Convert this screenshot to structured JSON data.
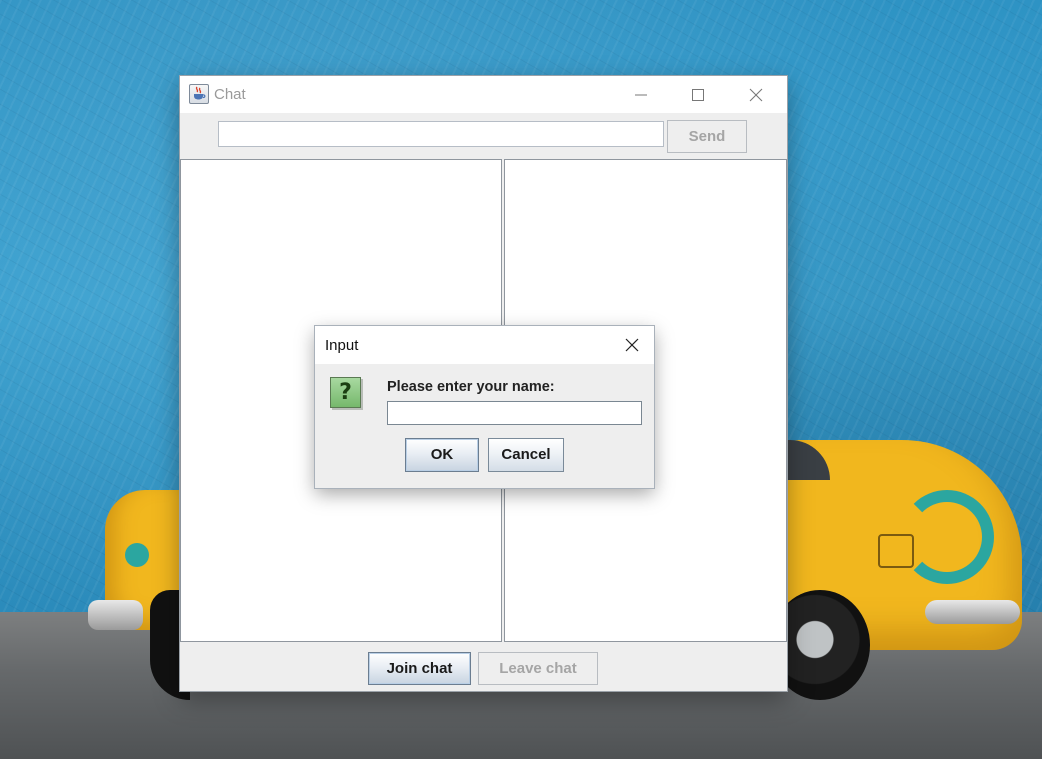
{
  "window": {
    "title": "Chat",
    "app_icon": "java-coffee-cup-icon",
    "controls": {
      "minimize": "minimize-icon",
      "maximize": "maximize-icon",
      "close": "close-icon"
    }
  },
  "toolbar": {
    "message_value": "",
    "send_label": "Send",
    "send_enabled": false
  },
  "panes": {
    "messages": [],
    "users": []
  },
  "bottombar": {
    "join_label": "Join chat",
    "join_enabled": true,
    "leave_label": "Leave chat",
    "leave_enabled": false
  },
  "dialog": {
    "title": "Input",
    "icon": "question-icon",
    "icon_glyph": "?",
    "prompt": "Please enter your name:",
    "name_value": "",
    "ok_label": "OK",
    "cancel_label": "Cancel"
  },
  "colors": {
    "window_bg": "#eeeeee",
    "disabled_text": "#a5a5a5",
    "question_icon_green": "#76b86c",
    "wallpaper_blue": "#2e93c4",
    "car_yellow": "#f1b71e"
  }
}
